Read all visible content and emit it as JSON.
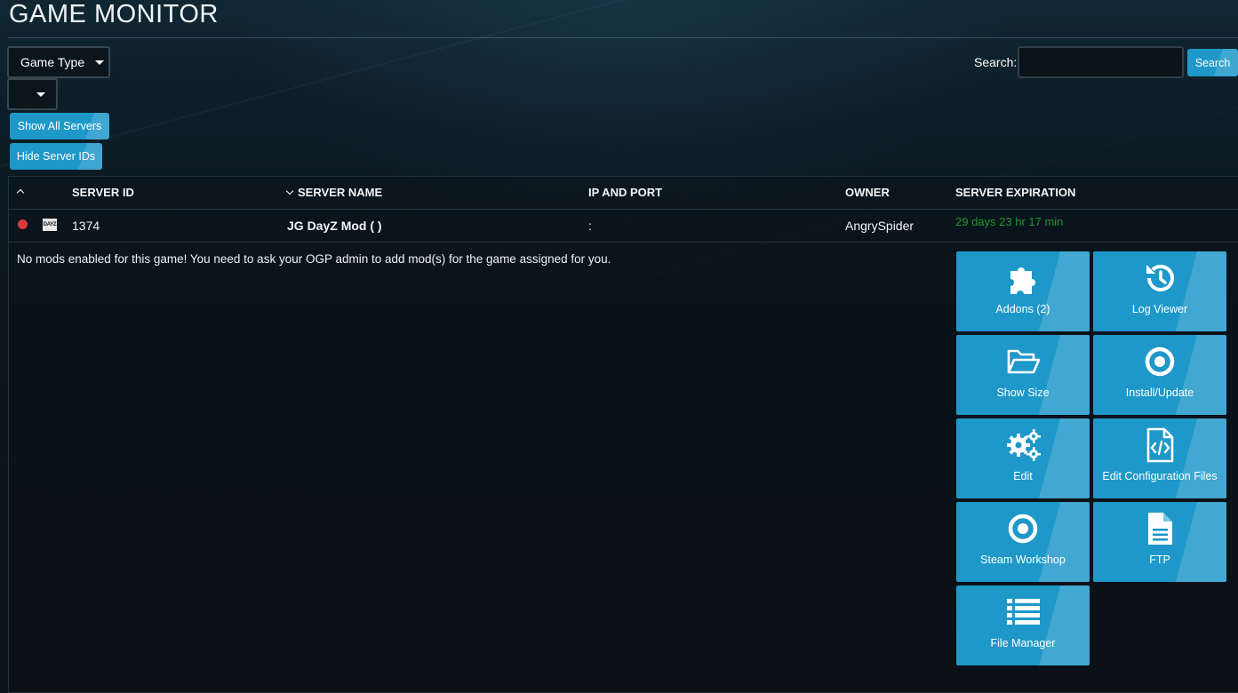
{
  "page": {
    "title": "GAME MONITOR"
  },
  "filters": {
    "game_type_label": "Game Type",
    "second_dropdown_value": "",
    "show_all_label": "Show All Servers",
    "hide_ids_label": "Hide Server IDs"
  },
  "search": {
    "label": "Search:",
    "value": "",
    "button_label": "Search"
  },
  "table": {
    "headers": {
      "server_id": "SERVER ID",
      "server_name": "SERVER NAME",
      "ip_port": "IP AND PORT",
      "owner": "OWNER",
      "expiration": "SERVER EXPIRATION"
    },
    "row": {
      "status": "offline",
      "status_color": "#d83b3b",
      "game_icon_text": "DAYZ",
      "server_id": "1374",
      "server_name": "JG DayZ Mod ( )",
      "ip_port": ":",
      "owner": "AngrySpider",
      "expiration": "29 days 23 hr 17 min",
      "expiration_color": "#1c9a2a"
    },
    "mods_message": "No mods enabled for this game! You need to ask your OGP admin to add mod(s) for the game assigned for you."
  },
  "actions": [
    {
      "label": "Addons (2)",
      "icon": "puzzle-icon"
    },
    {
      "label": "Log Viewer",
      "icon": "history-icon"
    },
    {
      "label": "Show Size",
      "icon": "folder-open-icon"
    },
    {
      "label": "Install/Update",
      "icon": "target-icon"
    },
    {
      "label": "Edit",
      "icon": "gears-icon"
    },
    {
      "label": "Edit Configuration Files",
      "icon": "code-file-icon"
    },
    {
      "label": "Steam Workshop",
      "icon": "target-icon"
    },
    {
      "label": "FTP",
      "icon": "file-text-icon"
    },
    {
      "label": "File Manager",
      "icon": "list-icon"
    }
  ],
  "colors": {
    "accent": "#1e98c9",
    "background": "#0b151d"
  }
}
